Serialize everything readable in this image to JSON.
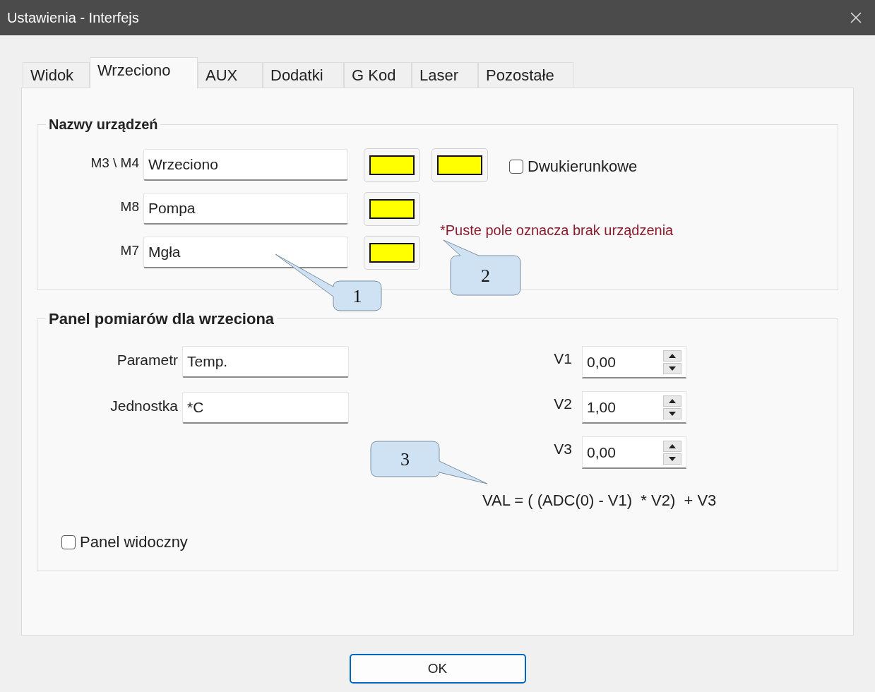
{
  "window": {
    "title": "Ustawienia - Interfejs"
  },
  "tabs": [
    {
      "label": "Widok",
      "selected": false
    },
    {
      "label": "Wrzeciono",
      "selected": true
    },
    {
      "label": "AUX",
      "selected": false
    },
    {
      "label": "Dodatki",
      "selected": false
    },
    {
      "label": "G Kod",
      "selected": false
    },
    {
      "label": "Laser",
      "selected": false
    },
    {
      "label": "Pozostałe",
      "selected": false
    }
  ],
  "devices_group": {
    "title": "Nazwy urządzeń",
    "rows": [
      {
        "label": "M3 \\ M4",
        "value": "Wrzeciono",
        "swatches": [
          {
            "color": "#ffff00"
          },
          {
            "color": "#ffff00"
          }
        ]
      },
      {
        "label": "M8",
        "value": "Pompa",
        "swatches": [
          {
            "color": "#ffff00"
          }
        ]
      },
      {
        "label": "M7",
        "value": "Mgła",
        "swatches": [
          {
            "color": "#ffff00"
          }
        ]
      }
    ],
    "bidirectional": {
      "label": "Dwukierunkowe",
      "checked": false
    },
    "note": "*Puste pole oznacza brak urządzenia"
  },
  "measure_group": {
    "title": "Panel pomiarów dla wrzeciona",
    "fields": [
      {
        "label": "Parametr",
        "value": "Temp."
      },
      {
        "label": "Jednostka",
        "value": "*C"
      }
    ],
    "spinners": [
      {
        "label": "V1",
        "value": "0,00"
      },
      {
        "label": "V2",
        "value": "1,00"
      },
      {
        "label": "V3",
        "value": "0,00"
      }
    ],
    "formula": "VAL = ( (ADC(0) - V1)  * V2)  + V3",
    "visible": {
      "label": "Panel widoczny",
      "checked": false
    }
  },
  "callouts": [
    "1",
    "2",
    "3"
  ],
  "buttons": [
    "OK"
  ]
}
